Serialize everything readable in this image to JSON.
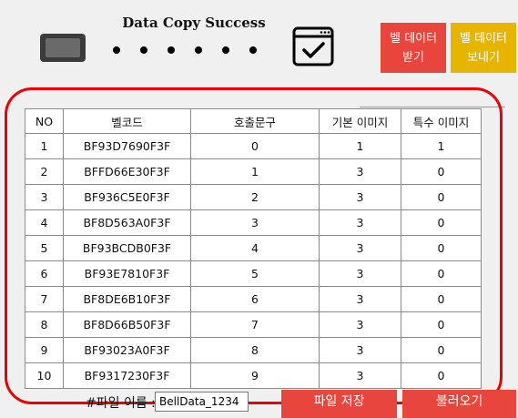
{
  "header": {
    "status": "Data Copy Success",
    "receive_button": [
      "벨 데이터",
      "받기"
    ],
    "send_button": [
      "벨 데이터",
      "보내기"
    ]
  },
  "icons": {
    "device": "device-icon",
    "transfer": "transfer-dots-icon",
    "complete": "window-check-icon"
  },
  "colors": {
    "red_button": "#e8453c",
    "yellow_button": "#e7b400",
    "highlight": "#e80000"
  },
  "table": {
    "columns": [
      "NO",
      "벨코드",
      "호출문구",
      "기본 이미지",
      "특수 이미지"
    ],
    "rows": [
      [
        "1",
        "BF93D7690F3F",
        "0",
        "1",
        "1"
      ],
      [
        "2",
        "BFFD66E30F3F",
        "1",
        "3",
        "0"
      ],
      [
        "3",
        "BF936C5E0F3F",
        "2",
        "3",
        "0"
      ],
      [
        "4",
        "BF8D563A0F3F",
        "3",
        "3",
        "0"
      ],
      [
        "5",
        "BF93BCDB0F3F",
        "4",
        "3",
        "0"
      ],
      [
        "6",
        "BF93E7810F3F",
        "5",
        "3",
        "0"
      ],
      [
        "7",
        "BF8DE6B10F3F",
        "6",
        "3",
        "0"
      ],
      [
        "8",
        "BF8D66B50F3F",
        "7",
        "3",
        "0"
      ],
      [
        "9",
        "BF93023A0F3F",
        "8",
        "3",
        "0"
      ],
      [
        "10",
        "BF9317230F3F",
        "9",
        "3",
        "0"
      ]
    ]
  },
  "footer": {
    "filename_label": "#파일 이름 :",
    "filename_value": "BellData_1234",
    "save_button": "파일 저장",
    "load_button": "불러오기"
  }
}
